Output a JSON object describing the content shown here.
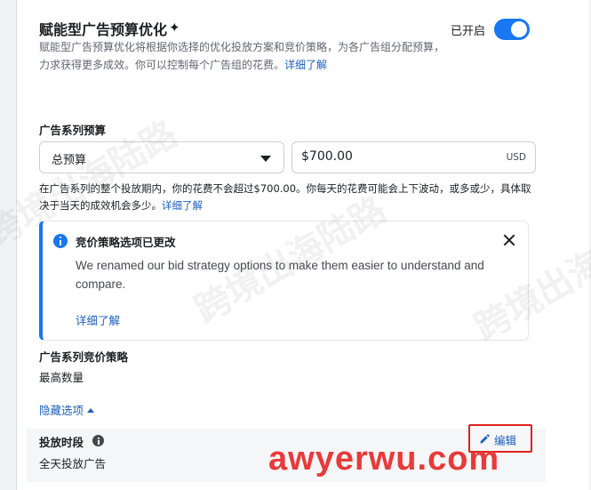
{
  "campaign_budget_optimization": {
    "title": "赋能型广告预算优化",
    "sparkle_icon": "sparkle-icon",
    "status_label": "已开启",
    "enabled": true,
    "description": "赋能型广告预算优化将根据你选择的优化投放方案和竞价策略，为各广告组分配预算，力求获得更多成效。你可以控制每个广告组的花费。",
    "learn_more": "详细了解"
  },
  "campaign_budget": {
    "label": "广告系列预算",
    "budget_type": "总预算",
    "amount": "$700.00",
    "currency": "USD",
    "note": "在广告系列的整个投放期内，你的花费不会超过$700.00。你每天的花费可能会上下波动，或多或少，具体取决于当天的成效机会多少。",
    "learn_more": "详细了解"
  },
  "notice": {
    "title": "竞价策略选项已更改",
    "body": "We renamed our bid strategy options to make them easier to understand and compare.",
    "learn_more": "详细了解"
  },
  "bid_strategy": {
    "label": "广告系列竞价策略",
    "value": "最高数量"
  },
  "hide_options": "隐藏选项",
  "schedule": {
    "label": "投放时段",
    "value": "全天投放广告",
    "edit_label": "编辑"
  },
  "watermark_text": "跨境出海陆路",
  "brand_watermark": "awyerwu.com",
  "colors": {
    "accent": "#1877f2",
    "link": "#1b5fbf",
    "highlight_box": "#e0201c",
    "brand": "#e83a3a"
  }
}
